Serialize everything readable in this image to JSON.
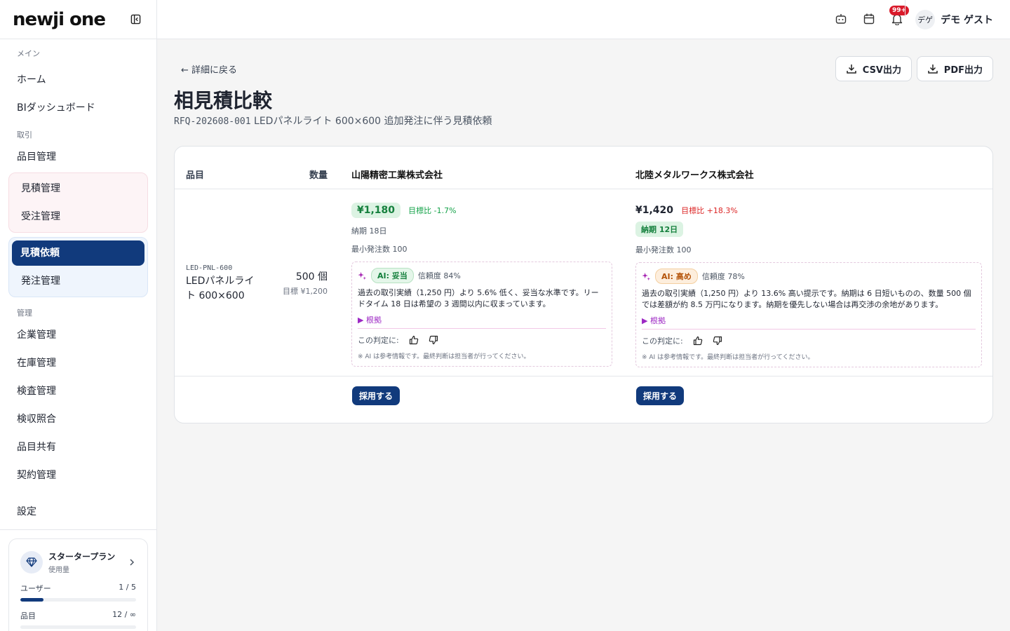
{
  "sidebar": {
    "logo": "newji one",
    "sections": {
      "main": "メイン",
      "trade": "取引",
      "admin": "管理"
    },
    "items": {
      "home": "ホーム",
      "bi": "BIダッシュボード",
      "items_mgmt": "品目管理",
      "quote_mgmt": "見積管理",
      "order_mgmt": "受注管理",
      "rfq": "見積依頼",
      "po_mgmt": "発注管理",
      "company": "企業管理",
      "inventory": "在庫管理",
      "inspection": "検査管理",
      "receiving": "検収照合",
      "item_share": "品目共有",
      "contract": "契約管理",
      "settings": "設定"
    },
    "plan": {
      "title": "スタータープラン",
      "subtitle": "使用量",
      "users_label": "ユーザー",
      "users_value": "1 / 5",
      "users_fraction": 0.2,
      "items_label": "品目",
      "items_value": "12 / ∞",
      "items_fraction": 0
    }
  },
  "topbar": {
    "notif_badge": "99+",
    "avatar_text": "デゲ",
    "user_name": "デモ ゲスト"
  },
  "page": {
    "back": "← 詳細に戻る",
    "csv_button": "CSV出力",
    "pdf_button": "PDF出力",
    "title": "相見積比較",
    "rfq_code": "RFQ-202608-001",
    "rfq_desc": "LEDパネルライト 600×600 追加発注に伴う見積依頼"
  },
  "table": {
    "col_item": "品目",
    "col_qty": "数量",
    "item_code": "LED-PNL-600",
    "item_name": "LEDパネルライト 600×600",
    "qty": "500 個",
    "qty_target": "目標 ¥1,200",
    "suppliers": [
      {
        "name": "山陽精密工業株式会社",
        "price": "¥1,180",
        "diff": "目標比 -1.7%",
        "lead": "納期 18日",
        "moq": "最小発注数 100",
        "ai_badge": "AI: 妥当",
        "confidence": "信頼度 84%",
        "ai_text": "過去の取引実績（1,250 円）より 5.6% 低く、妥当な水準です。リードタイム 18 日は希望の 3 週間以内に収まっています。",
        "basis": "▶ 根拠",
        "feedback": "この判定に:",
        "note": "※ AI は参考情報です。最終判断は担当者が行ってください。",
        "adopt": "採用する"
      },
      {
        "name": "北陸メタルワークス株式会社",
        "price": "¥1,420",
        "diff": "目標比 +18.3%",
        "lead": "納期 12日",
        "moq": "最小発注数 100",
        "ai_badge": "AI: 高め",
        "confidence": "信頼度 78%",
        "ai_text": "過去の取引実績（1,250 円）より 13.6% 高い提示です。納期は 6 日短いものの、数量 500 個では差額が約 8.5 万円になります。納期を優先しない場合は再交渉の余地があります。",
        "basis": "▶ 根拠",
        "feedback": "この判定に:",
        "note": "※ AI は参考情報です。最終判断は担当者が行ってください。",
        "adopt": "採用する"
      }
    ]
  },
  "colors": {
    "primary": "#113a7c",
    "green": "#15803d",
    "red": "#dc2626",
    "ai_purple": "#9d28c4"
  },
  "icons": [
    "collapse-sidebar-icon",
    "robot-icon",
    "calendar-icon",
    "bell-icon",
    "download-icon",
    "diamond-icon",
    "chevron-right-icon",
    "sparkle-icon",
    "thumbs-up-icon",
    "thumbs-down-icon"
  ]
}
